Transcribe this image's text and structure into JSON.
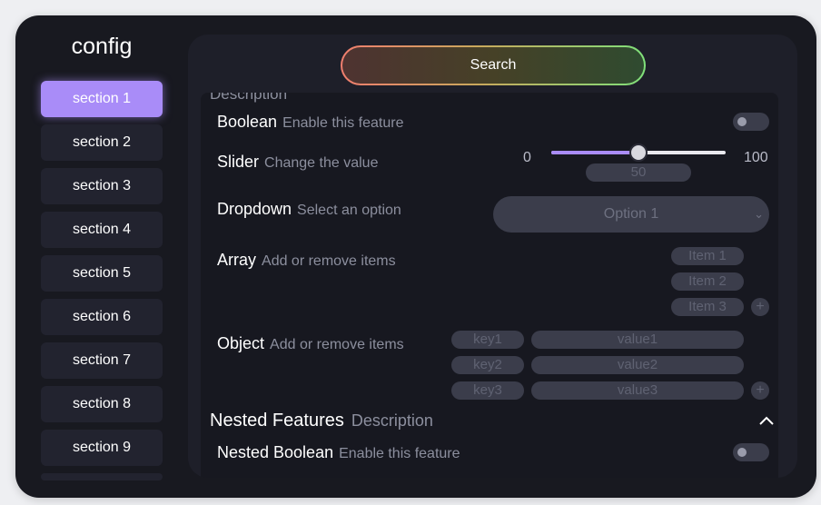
{
  "app": {
    "title": "config"
  },
  "sidebar": {
    "items": [
      {
        "label": "section 1"
      },
      {
        "label": "section 2"
      },
      {
        "label": "section 3"
      },
      {
        "label": "section 4"
      },
      {
        "label": "section 5"
      },
      {
        "label": "section 6"
      },
      {
        "label": "section 7"
      },
      {
        "label": "section 8"
      },
      {
        "label": "section 9"
      }
    ]
  },
  "search": {
    "label": "Search"
  },
  "panel": {
    "partial_header": "Description",
    "boolean": {
      "label": "Boolean",
      "description": "Enable this feature",
      "enabled": false
    },
    "slider": {
      "label": "Slider",
      "description": "Change the value",
      "min": "0",
      "max": "100",
      "value": "50",
      "fraction": 0.5
    },
    "dropdown": {
      "label": "Dropdown",
      "description": "Select an option",
      "selected": "Option 1"
    },
    "array": {
      "label": "Array",
      "description": "Add or remove items",
      "items": [
        "Item 1",
        "Item 2",
        "Item 3"
      ]
    },
    "object": {
      "label": "Object",
      "description": "Add or remove items",
      "entries": [
        {
          "key": "key1",
          "value": "value1"
        },
        {
          "key": "key2",
          "value": "value2"
        },
        {
          "key": "key3",
          "value": "value3"
        }
      ]
    },
    "nested": {
      "title": "Nested Features",
      "description": "Description",
      "boolean": {
        "label": "Nested Boolean",
        "description": "Enable this feature",
        "enabled": false
      }
    }
  },
  "colors": {
    "accent": "#a98cf8",
    "background": "#181920",
    "panel": "#171820",
    "control": "#3b3d4b",
    "muted_text": "#8c8f9e"
  },
  "icons": {
    "plus": "plus-icon",
    "chevron_down": "chevron-down-icon",
    "chevron_up": "chevron-up-icon"
  }
}
